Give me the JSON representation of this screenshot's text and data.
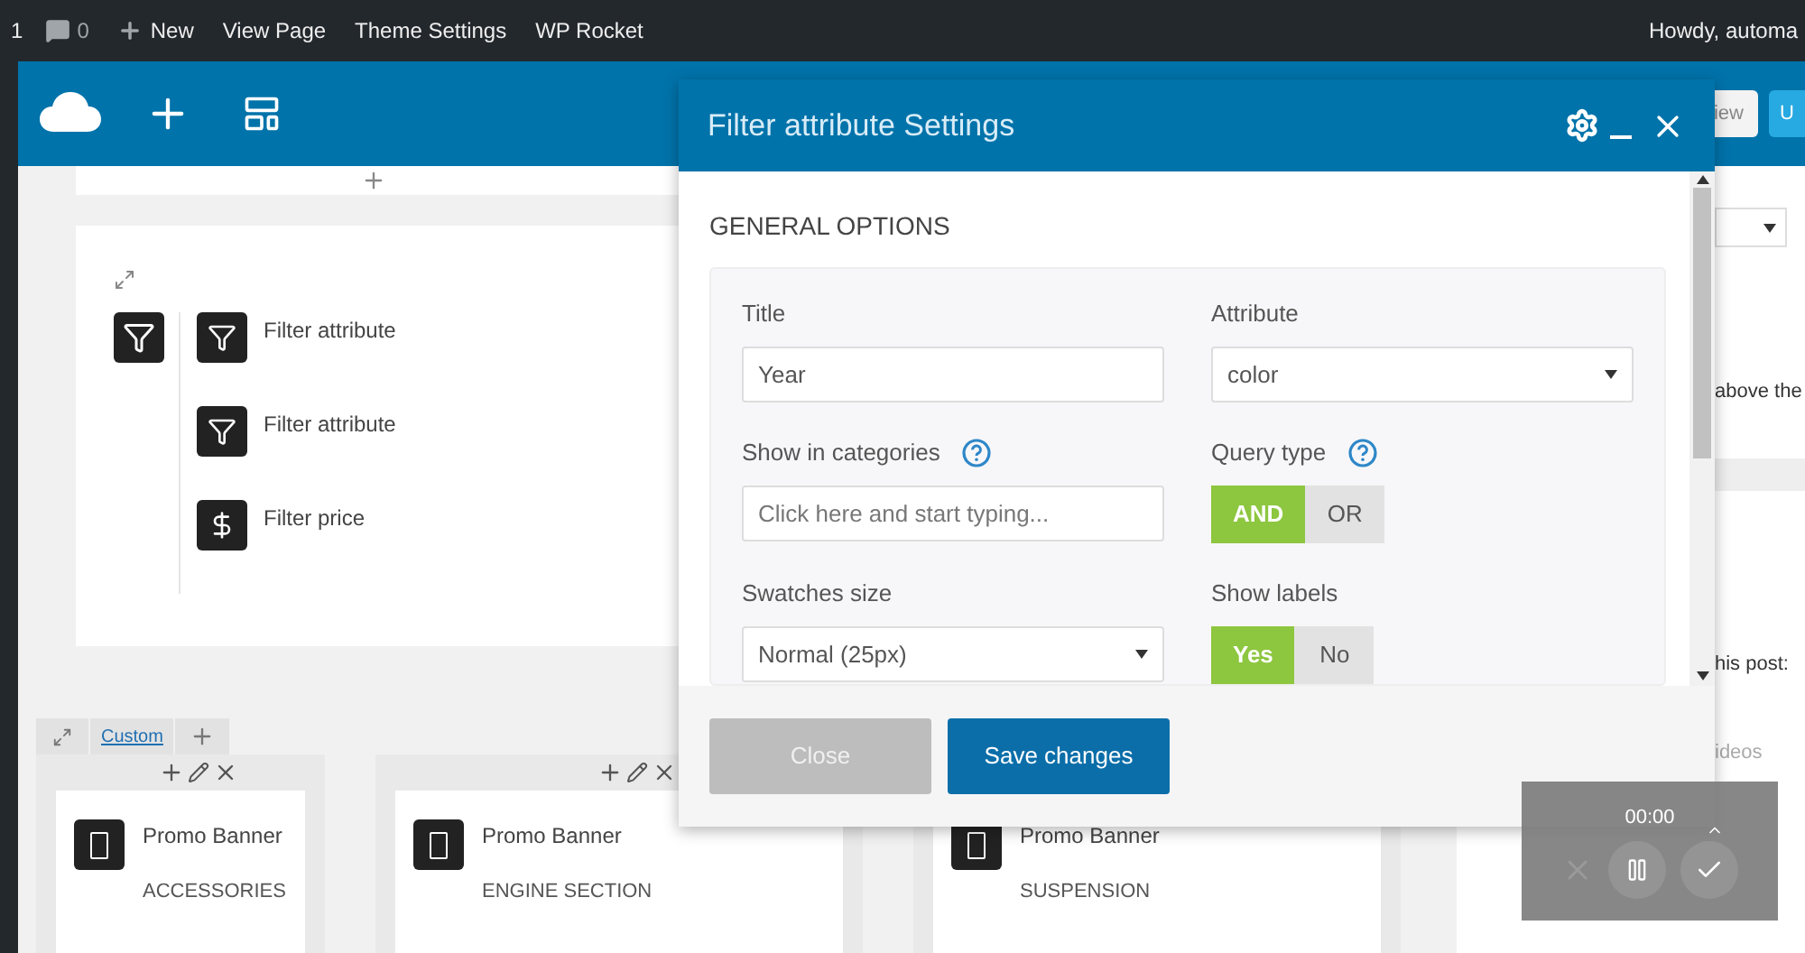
{
  "admin_bar": {
    "items": [
      {
        "kind": "count",
        "label": "1"
      },
      {
        "kind": "comments",
        "label": "0"
      },
      {
        "kind": "new",
        "label": "New"
      },
      {
        "kind": "link",
        "label": "View Page"
      },
      {
        "kind": "link",
        "label": "Theme Settings"
      },
      {
        "kind": "link",
        "label": "WP Rocket"
      }
    ],
    "greeting": "Howdy, automa"
  },
  "builder_toolbar": {
    "preview": "iew",
    "update": "U"
  },
  "canvas": {
    "filter_items": [
      {
        "kind": "attribute",
        "label": "Filter attribute"
      },
      {
        "kind": "attribute",
        "label": "Filter attribute"
      },
      {
        "kind": "price",
        "label": "Filter price"
      }
    ],
    "tab": "Custom",
    "banners": [
      {
        "title": "Promo Banner",
        "subtitle": "ACCESSORIES"
      },
      {
        "title": "Promo Banner",
        "subtitle": "ENGINE SECTION"
      },
      {
        "title": "Promo Banner",
        "subtitle": "SUSPENSION"
      }
    ]
  },
  "sidebar": {
    "texts": [
      "above the",
      "his post:",
      "ideos"
    ]
  },
  "modal": {
    "title": "Filter attribute Settings",
    "section": "GENERAL OPTIONS",
    "fields": [
      {
        "kind": "text",
        "label": "Title",
        "value": "Year"
      },
      {
        "kind": "select",
        "label": "Attribute",
        "value": "color"
      },
      {
        "kind": "text",
        "label": "Show in categories",
        "help": true,
        "placeholder": "Click here and start typing..."
      },
      {
        "kind": "toggle",
        "label": "Query type",
        "help": true,
        "options": [
          {
            "label": "AND",
            "selected": true
          },
          {
            "label": "OR",
            "selected": false
          }
        ]
      },
      {
        "kind": "select",
        "label": "Swatches size",
        "value": "Normal (25px)"
      },
      {
        "kind": "toggle",
        "label": "Show labels",
        "options": [
          {
            "label": "Yes",
            "selected": true
          },
          {
            "label": "No",
            "selected": false
          }
        ]
      }
    ],
    "buttons": [
      {
        "kind": "secondary",
        "label": "Close"
      },
      {
        "kind": "primary",
        "label": "Save changes"
      }
    ]
  },
  "recorder": {
    "time": "00:00"
  }
}
